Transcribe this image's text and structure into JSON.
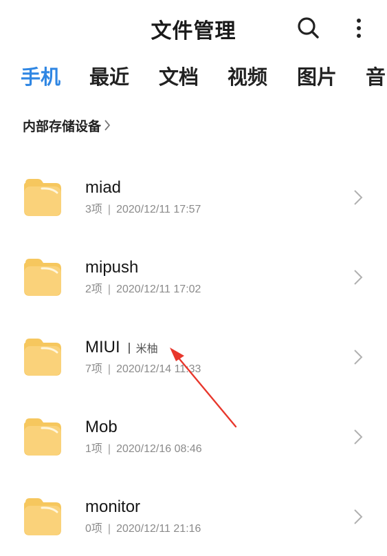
{
  "header": {
    "title": "文件管理",
    "icons": {
      "search": "search-icon",
      "more": "more-vertical-icon"
    }
  },
  "tabs": [
    {
      "label": "手机",
      "active": true
    },
    {
      "label": "最近",
      "active": false
    },
    {
      "label": "文档",
      "active": false
    },
    {
      "label": "视频",
      "active": false
    },
    {
      "label": "图片",
      "active": false
    },
    {
      "label": "音",
      "active": false
    }
  ],
  "breadcrumb": {
    "label": "内部存储设备"
  },
  "folders": [
    {
      "name": "miad",
      "tag": "",
      "count": "3项",
      "date": "2020/12/11 17:57"
    },
    {
      "name": "mipush",
      "tag": "",
      "count": "2项",
      "date": "2020/12/11 17:02"
    },
    {
      "name": "MIUI",
      "tag": "米柚",
      "count": "7项",
      "date": "2020/12/14 11:33"
    },
    {
      "name": "Mob",
      "tag": "",
      "count": "1项",
      "date": "2020/12/16 08:46"
    },
    {
      "name": "monitor",
      "tag": "",
      "count": "0项",
      "date": "2020/12/11 21:16"
    }
  ],
  "colors": {
    "accent": "#2f86e3",
    "folder": "#f9cf72",
    "annotation_arrow": "#e8372c"
  }
}
